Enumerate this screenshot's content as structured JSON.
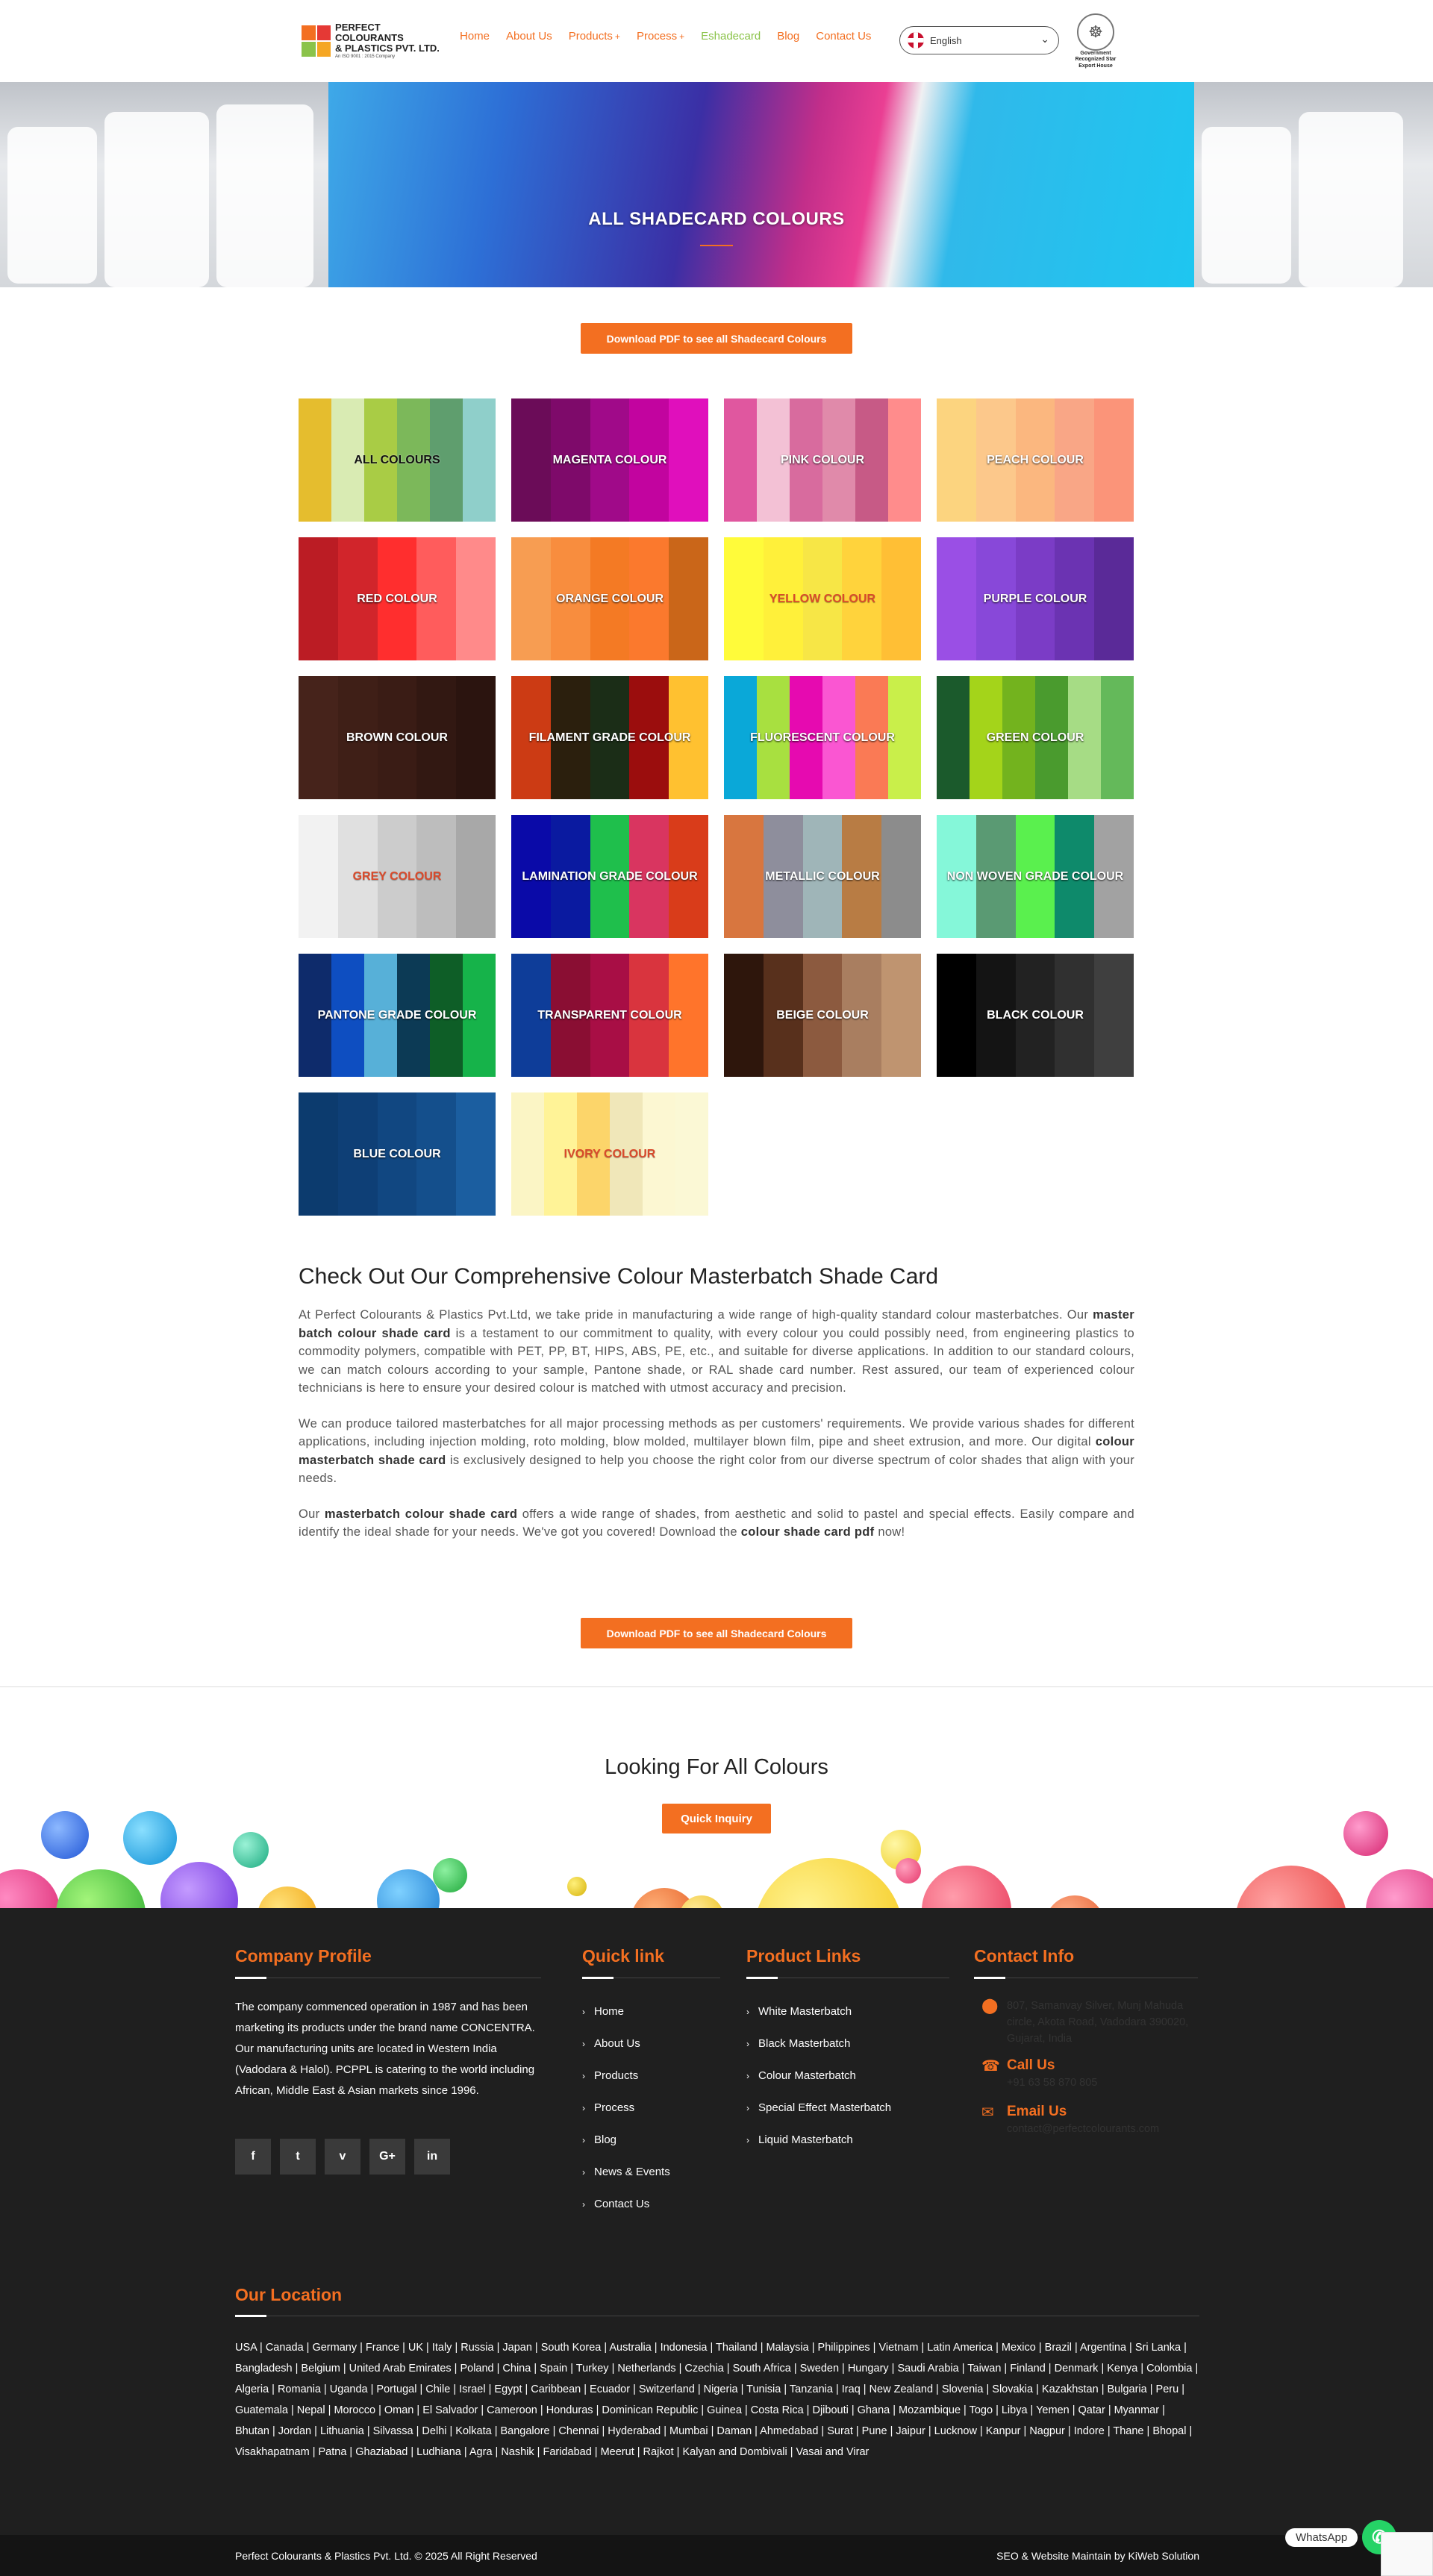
{
  "header": {
    "logo": {
      "line1": "PERFECT COLOURANTS",
      "line2": "& PLASTICS PVT. LTD.",
      "line3": "An ISO 9001 : 2015 Company"
    },
    "nav": [
      {
        "label": "Home"
      },
      {
        "label": "About Us"
      },
      {
        "label": "Products",
        "has_sub": true
      },
      {
        "label": "Process",
        "has_sub": true
      },
      {
        "label": "Eshadecard",
        "active": true
      },
      {
        "label": "Blog"
      },
      {
        "label": "Contact Us"
      }
    ],
    "language": "English",
    "gov_badge": "Government Recognized Star Export House"
  },
  "banner": {
    "title": "ALL SHADECARD COLOURS"
  },
  "download_label": "Download PDF to see all Shadecard Colours",
  "shade_cards": [
    {
      "label": "ALL COLOURS",
      "dark_text": true,
      "colors": [
        "#e5bd2e",
        "#d9ebb3",
        "#a9cc45",
        "#7cb85a",
        "#5f9e6e",
        "#8fcfca"
      ]
    },
    {
      "label": "MAGENTA COLOUR",
      "colors": [
        "#6b0c58",
        "#7e0a6a",
        "#a00a89",
        "#c2049f",
        "#e00fbc"
      ]
    },
    {
      "label": "PINK COLOUR",
      "colors": [
        "#e0579f",
        "#f3c1d5",
        "#d86b9e",
        "#e08aaa",
        "#c75a86",
        "#ff8c8c"
      ]
    },
    {
      "label": "PEACH COLOUR",
      "colors": [
        "#fcd47f",
        "#fcc88b",
        "#fbb77f",
        "#f9a686",
        "#fb9479"
      ]
    },
    {
      "label": "RED COLOUR",
      "colors": [
        "#bb1c24",
        "#d1252b",
        "#ff2e2e",
        "#ff5c5c",
        "#ff8a8a"
      ]
    },
    {
      "label": "ORANGE COLOUR",
      "colors": [
        "#f79d52",
        "#f88d3e",
        "#f47a24",
        "#fb792d",
        "#ca6619"
      ]
    },
    {
      "label": "YELLOW COLOUR",
      "red_text": true,
      "colors": [
        "#fffb3a",
        "#fff03a",
        "#f7e646",
        "#ffd33c",
        "#ffbf35"
      ]
    },
    {
      "label": "PURPLE COLOUR",
      "colors": [
        "#9a4fe5",
        "#8848d9",
        "#7b3cc6",
        "#6b33b2",
        "#5a2a98"
      ]
    },
    {
      "label": "BROWN COLOUR",
      "colors": [
        "#46231b",
        "#3f1f17",
        "#3a1c15",
        "#321812",
        "#2b140f"
      ]
    },
    {
      "label": "FILAMENT GRADE COLOUR",
      "colors": [
        "#cc3b14",
        "#2b1f0d",
        "#1b2d17",
        "#9b0d0d",
        "#ffc130"
      ]
    },
    {
      "label": "FLUORESCENT COLOUR",
      "colors": [
        "#0aa8d8",
        "#a8e040",
        "#e60ab0",
        "#fa56d2",
        "#fa7a55",
        "#c9ef4a"
      ]
    },
    {
      "label": "GREEN COLOUR",
      "colors": [
        "#1b5a2c",
        "#a4d41a",
        "#73b31e",
        "#4a9b2e",
        "#a6dc85",
        "#64b95a"
      ]
    },
    {
      "label": "GREY COLOUR",
      "red_text": true,
      "colors": [
        "#f2f2f2",
        "#e0e0e0",
        "#cccccc",
        "#bdbdbd",
        "#a8a8a8"
      ]
    },
    {
      "label": "LAMINATION GRADE COLOUR",
      "colors": [
        "#0a0aa8",
        "#0a1aa0",
        "#1fbf4c",
        "#d93560",
        "#d93c1a"
      ]
    },
    {
      "label": "METALLIC COLOUR",
      "colors": [
        "#d8763f",
        "#8e8e9c",
        "#9fb5b8",
        "#b87c44",
        "#8c8c8c"
      ]
    },
    {
      "label": "NON WOVEN GRADE COLOUR",
      "colors": [
        "#85f7d9",
        "#5a9a73",
        "#5af04e",
        "#0e8a6b",
        "#a2a2a2"
      ]
    },
    {
      "label": "PANTONE GRADE COLOUR",
      "colors": [
        "#0e2b6b",
        "#0e4ec1",
        "#57b0d8",
        "#0c3a55",
        "#0e5e27",
        "#16b34a"
      ]
    },
    {
      "label": "TRANSPARENT COLOUR",
      "colors": [
        "#0e3d99",
        "#8a0e33",
        "#a80e45",
        "#d9343e",
        "#ff742b"
      ]
    },
    {
      "label": "BEIGE COLOUR",
      "colors": [
        "#2e160c",
        "#58301c",
        "#8c5a3f",
        "#a97e60",
        "#bf9470"
      ]
    },
    {
      "label": "BLACK COLOUR",
      "colors": [
        "#000000",
        "#141414",
        "#222222",
        "#303030",
        "#3f3f3f"
      ]
    },
    {
      "label": "BLUE COLOUR",
      "colors": [
        "#0c3b6e",
        "#0e3f76",
        "#114781",
        "#144f8c",
        "#1b5ea0"
      ]
    },
    {
      "label": "IVORY COLOUR",
      "red_text": true,
      "colors": [
        "#fbf5c5",
        "#fff397",
        "#fcd56a",
        "#f0e7b9",
        "#fcf7d2",
        "#fbf8d5"
      ]
    }
  ],
  "content": {
    "heading": "Check Out Our Comprehensive Colour Masterbatch Shade Card",
    "p1_a": "At Perfect Colourants & Plastics Pvt.Ltd, we take pride in manufacturing a wide range of high-quality standard colour masterbatches. Our ",
    "p1_b": "master batch colour shade card",
    "p1_c": " is a testament to our commitment to quality, with every colour you could possibly need, from engineering plastics to commodity polymers, compatible with PET, PP, BT, HIPS, ABS, PE, etc., and suitable for diverse applications. In addition to our standard colours, we can match colours according to your sample, Pantone shade, or RAL shade card number.  Rest assured, our team of experienced colour technicians is here to ensure your desired colour is matched with utmost accuracy and precision.",
    "p2_a": "We can produce tailored masterbatches for all major processing methods as per customers' requirements. We provide various shades for different applications, including injection molding, roto molding, blow molded, multilayer blown film, pipe and sheet extrusion, and more. Our digital ",
    "p2_b": "colour masterbatch shade card",
    "p2_c": " is exclusively designed to help you choose the right color from our diverse spectrum of color shades that align with your needs.",
    "p3_a": "Our ",
    "p3_b": "masterbatch colour shade card",
    "p3_c": " offers a wide range of shades, from aesthetic and solid to pastel and special effects. Easily compare and identify the ideal shade for your needs. We've got you covered! Download the ",
    "p3_d": "colour shade card pdf",
    "p3_e": " now!"
  },
  "looking": {
    "title": "Looking For All Colours",
    "button": "Quick Inquiry"
  },
  "footer": {
    "company_profile": {
      "title": "Company Profile",
      "text": "The company commenced operation in 1987 and has been marketing its products under the brand name CONCENTRA. Our manufacturing units are located in Western India (Vadodara & Halol). PCPPL is catering to the world including African, Middle East & Asian markets since 1996."
    },
    "social": [
      "f",
      "t",
      "v",
      "G+",
      "in"
    ],
    "quick_link": {
      "title": "Quick link",
      "items": [
        "Home",
        "About Us",
        "Products",
        "Process",
        "Blog",
        "News & Events",
        "Contact Us"
      ]
    },
    "product_links": {
      "title": "Product Links",
      "items": [
        "White Masterbatch",
        "Black Masterbatch",
        "Colour Masterbatch",
        "Special Effect Masterbatch",
        "Liquid Masterbatch"
      ]
    },
    "contact": {
      "title": "Contact Info",
      "address": "807, Samanvay Silver, Munj Mahuda circle, Akota Road, Vadodara 390020, Gujarat, India",
      "call_title": "Call Us",
      "phone": "+91 63 58 870 805",
      "email_title": "Email Us",
      "email": "contact@perfectcolourants.com"
    },
    "location": {
      "title": "Our Location",
      "text": "USA | Canada | Germany | France | UK | Italy | Russia | Japan | South Korea | Australia | Indonesia | Thailand | Malaysia | Philippines | Vietnam | Latin America | Mexico | Brazil | Argentina | Sri Lanka | Bangladesh | Belgium | United Arab Emirates | Poland | China | Spain | Turkey | Netherlands | Czechia | South Africa | Sweden | Hungary | Saudi Arabia | Taiwan | Finland | Denmark | Kenya | Colombia | Algeria | Romania | Uganda | Portugal | Chile | Israel | Egypt | Caribbean | Ecuador | Switzerland | Nigeria | Tunisia | Tanzania | Iraq | New Zealand | Slovenia | Slovakia | Kazakhstan | Bulgaria | Peru | Guatemala | Nepal | Morocco | Oman | El Salvador | Cameroon | Honduras | Dominican Republic | Guinea | Costa Rica | Djibouti | Ghana | Mozambique | Togo | Libya | Yemen | Qatar | Myanmar | Bhutan | Jordan | Lithuania | Silvassa | Delhi | Kolkata | Bangalore | Chennai | Hyderabad | Mumbai | Daman | Ahmedabad | Surat | Pune | Jaipur | Lucknow | Kanpur | Nagpur | Indore | Thane | Bhopal | Visakhapatnam | Patna | Ghaziabad | Ludhiana | Agra | Nashik | Faridabad | Meerut | Rajkot | Kalyan and Dombivali | Vasai and Virar"
    },
    "copyright": "Perfect Colourants & Plastics Pvt. Ltd. © 2025 All Right Reserved",
    "credit": "SEO & Website Maintain by KiWeb Solution",
    "whatsapp": "WhatsApp"
  }
}
